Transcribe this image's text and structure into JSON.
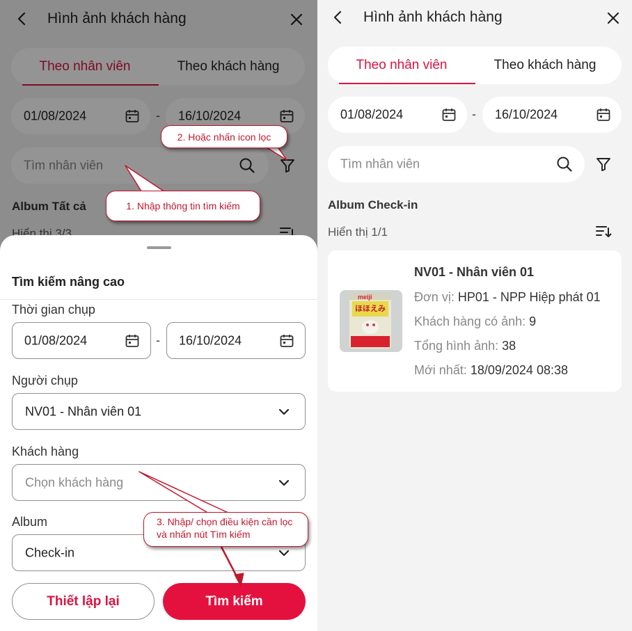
{
  "header": {
    "title": "Hình ảnh khách hàng"
  },
  "tabs": [
    {
      "label": "Theo nhân viên",
      "active": true
    },
    {
      "label": "Theo khách hàng",
      "active": false
    }
  ],
  "date_range": {
    "from": "01/08/2024",
    "to": "16/10/2024",
    "separator": "-"
  },
  "search": {
    "placeholder": "Tìm nhân viên"
  },
  "left_bg": {
    "album_label": "Album Tất cả",
    "count_text": "Hiển thị 3/3"
  },
  "sheet": {
    "title": "Tìm kiếm nâng cao",
    "capture_time_label": "Thời gian chụp",
    "capture_from": "01/08/2024",
    "capture_to": "16/10/2024",
    "photographer_label": "Người chụp",
    "photographer_value": "NV01 - Nhân viên 01",
    "customer_label": "Khách hàng",
    "customer_placeholder": "Chọn khách hàng",
    "album_label": "Album",
    "album_value": "Check-in",
    "reset_button": "Thiết lập lại",
    "search_button": "Tìm kiếm"
  },
  "callouts": {
    "c1": "1. Nhập thông tin tìm kiếm",
    "c2": "2. Hoặc nhấn icon lọc",
    "c3": "3. Nhập/ chọn điều kiện cần lọc và nhấn nút Tìm kiếm"
  },
  "results": {
    "album_label": "Album Check-in",
    "count_text": "Hiển thị 1/1",
    "card": {
      "name": "NV01 - Nhân viên 01",
      "unit_label": "Đơn vị:",
      "unit_value": "HP01 - NPP Hiệp phát 01",
      "customers_label": "Khách hàng có ảnh:",
      "customers_value": "9",
      "total_label": "Tổng hình ảnh:",
      "total_value": "38",
      "latest_label": "Mới nhất:",
      "latest_value": "18/09/2024 08:38",
      "thumb_text": "ほほえみ",
      "thumb_brand": "meiji"
    }
  },
  "colors": {
    "accent": "#d91440",
    "bg": "#f3f3f3",
    "callout": "#c0182e"
  },
  "icons": [
    "back-arrow-icon",
    "close-icon",
    "calendar-icon",
    "search-icon",
    "filter-icon",
    "sort-icon",
    "chevron-down-icon"
  ]
}
